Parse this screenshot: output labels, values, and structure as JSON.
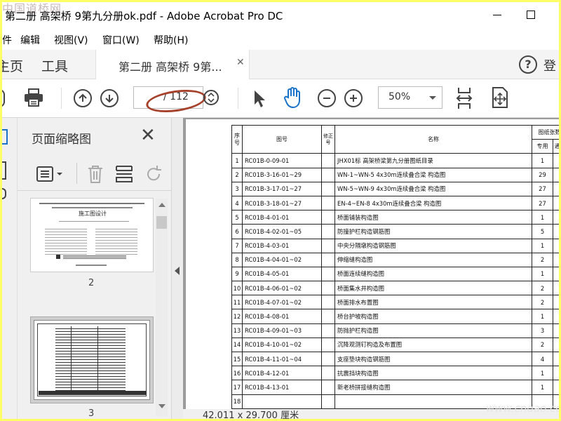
{
  "app": {
    "title": "第二册 高架桥 9第九分册ok.pdf - Adobe Acrobat Pro DC",
    "watermark": "中国道桥网"
  },
  "menu": [
    "件",
    "编辑",
    "视图(V)",
    "窗口(W)",
    "帮助(H)"
  ],
  "tabs": {
    "home": "主页",
    "tools": "工具",
    "document": "第二册 高架桥 9第...",
    "user": "登"
  },
  "toolbar": {
    "page_current": "",
    "page_total": "/ 112",
    "zoom": "50%"
  },
  "sidebar": {
    "title": "页面缩略图",
    "thumbnails": [
      {
        "label": "2",
        "heading": "施工图设计"
      },
      {
        "label": "3"
      }
    ]
  },
  "document": {
    "table": {
      "headers": {
        "seq": "序号",
        "drawing_no": "图号",
        "rev": "修正号",
        "name": "名称",
        "sheet_count": "图纸张数",
        "sub_special": "专用",
        "sub_general": "通用"
      },
      "rows": [
        {
          "seq": "1",
          "no": "RC01B-0-09-01",
          "name": "JHX01标 高架桥梁第九分册图纸目录",
          "count": "1"
        },
        {
          "seq": "2",
          "no": "RC01B-3-16-01~29",
          "name": "WN-1~WN-5 4x30m连续叠合梁 构造图",
          "count": "29"
        },
        {
          "seq": "3",
          "no": "RC01B-3-17-01~27",
          "name": "WN-5~WN-9 4x30m连续叠合梁 构造图",
          "count": "27"
        },
        {
          "seq": "4",
          "no": "RC01B-3-18-01~27",
          "name": "EN-4~EN-8 4x30m连续叠合梁 构造图",
          "count": "27"
        },
        {
          "seq": "5",
          "no": "RC01B-4-01-01",
          "name": "桥面铺装构造图",
          "count": "1"
        },
        {
          "seq": "6",
          "no": "RC01B-4-02-01~05",
          "name": "防撞护栏构造钢筋图",
          "count": "5"
        },
        {
          "seq": "7",
          "no": "RC01B-4-03-01",
          "name": "中央分隔墩构造钢筋图",
          "count": "1"
        },
        {
          "seq": "8",
          "no": "RC01B-4-04-01~02",
          "name": "伸缩缝构造图",
          "count": "2"
        },
        {
          "seq": "9",
          "no": "RC01B-4-05-01",
          "name": "桥面连续缝构造图",
          "count": "1"
        },
        {
          "seq": "10",
          "no": "RC01B-4-06-01~02",
          "name": "桥面集水井构造图",
          "count": "2"
        },
        {
          "seq": "11",
          "no": "RC01B-4-07-01~02",
          "name": "桥面排水布置图",
          "count": "2"
        },
        {
          "seq": "12",
          "no": "RC01B-4-08-01",
          "name": "桥台护坡构造图",
          "count": "1"
        },
        {
          "seq": "13",
          "no": "RC01B-4-09-01~03",
          "name": "防抛护栏构造图",
          "count": "3"
        },
        {
          "seq": "14",
          "no": "RC01B-4-10-01~02",
          "name": "沉降观测钉构造及布置图",
          "count": "2"
        },
        {
          "seq": "15",
          "no": "RC01B-4-11-01~04",
          "name": "支座垫块构造钢筋图",
          "count": "4"
        },
        {
          "seq": "16",
          "no": "RC01B-4-12-01",
          "name": "抗震挡块构造图",
          "count": "1"
        },
        {
          "seq": "17",
          "no": "RC01B-4-13-01",
          "name": "新老桥拼接缝构造图",
          "count": "1"
        },
        {
          "seq": "18",
          "no": "",
          "name": "",
          "count": ""
        }
      ]
    }
  },
  "status": {
    "page_size": "42.011 x 29.700 厘米"
  },
  "site_watermark": "www.cndao.com"
}
